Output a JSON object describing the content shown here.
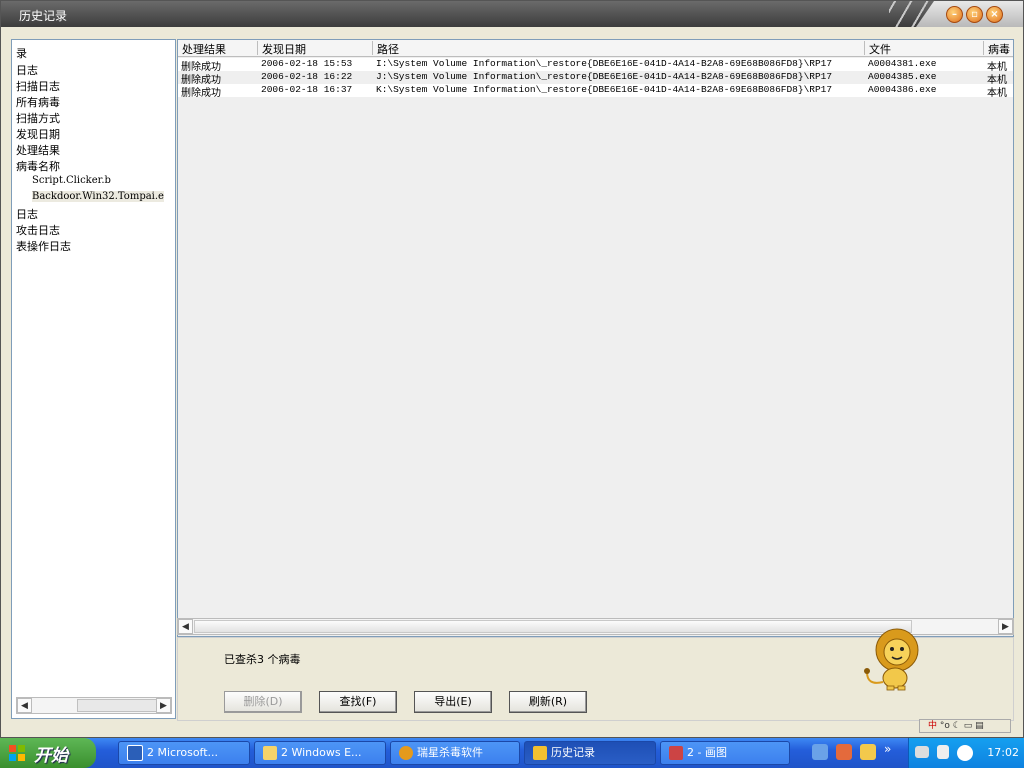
{
  "window": {
    "title": "历史记录"
  },
  "tree": {
    "items": [
      {
        "label": "录",
        "sub": false
      },
      {
        "label": "日志",
        "sub": false
      },
      {
        "label": "扫描日志",
        "sub": false
      },
      {
        "label": "所有病毒",
        "sub": false
      },
      {
        "label": "扫描方式",
        "sub": false
      },
      {
        "label": "发现日期",
        "sub": false
      },
      {
        "label": "处理结果",
        "sub": false
      },
      {
        "label": "病毒名称",
        "sub": false
      },
      {
        "label": "Script.Clicker.b",
        "sub": true
      },
      {
        "label": "Backdoor.Win32.Tompai.e",
        "sub": true,
        "selected": true
      },
      {
        "label": "日志",
        "sub": false
      },
      {
        "label": "攻击日志",
        "sub": false
      },
      {
        "label": "表操作日志",
        "sub": false
      }
    ]
  },
  "table": {
    "columns": [
      "处理结果",
      "发现日期",
      "路径",
      "文件",
      "病毒"
    ],
    "rows": [
      {
        "result": "删除成功",
        "date": "2006-02-18 15:53",
        "path": "I:\\System Volume Information\\_restore{DBE6E16E-041D-4A14-B2A8-69E68B086FD8}\\RP17",
        "file": "A0004381.exe",
        "virus": "本机"
      },
      {
        "result": "删除成功",
        "date": "2006-02-18 16:22",
        "path": "J:\\System Volume Information\\_restore{DBE6E16E-041D-4A14-B2A8-69E68B086FD8}\\RP17",
        "file": "A0004385.exe",
        "virus": "本机"
      },
      {
        "result": "删除成功",
        "date": "2006-02-18 16:37",
        "path": "K:\\System Volume Information\\_restore{DBE6E16E-041D-4A14-B2A8-69E68B086FD8}\\RP17",
        "file": "A0004386.exe",
        "virus": "本机"
      }
    ]
  },
  "status": "已查杀3 个病毒",
  "buttons": {
    "delete": "删除(D)",
    "find": "查找(F)",
    "export": "导出(E)",
    "refresh": "刷新(R)"
  },
  "taskbar": {
    "start": "开始",
    "items": [
      {
        "label": "2 Microsoft...",
        "icon": "word-icon"
      },
      {
        "label": "2 Windows E...",
        "icon": "folder-icon"
      },
      {
        "label": "瑞星杀毒软件",
        "icon": "rising-icon"
      },
      {
        "label": "历史记录",
        "icon": "history-icon",
        "active": true
      },
      {
        "label": "2 - 画图",
        "icon": "paint-icon"
      }
    ],
    "clock": "17:02"
  }
}
